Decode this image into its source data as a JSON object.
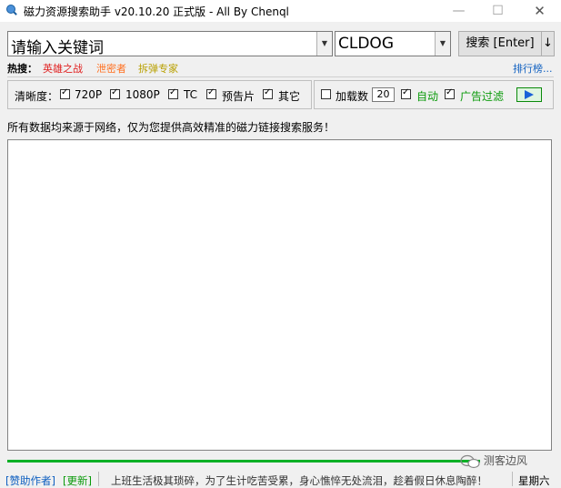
{
  "window": {
    "title": "磁力资源搜索助手 v20.10.20 正式版 - All By Chenql",
    "minimize_glyph": "—",
    "maximize_glyph": "☐",
    "close_glyph": "✕"
  },
  "search": {
    "keyword_value": "请输入关键词",
    "engine_value": "CLDOG",
    "search_button_label": "搜索 [Enter]",
    "down_button_label": "↓"
  },
  "hot": {
    "label": "热搜：",
    "items": [
      "英雄之战",
      "泄密者",
      "拆弹专家"
    ],
    "colors": [
      "#e02020",
      "#ff7020",
      "#b8a000"
    ],
    "rank_link": "排行榜..."
  },
  "filters": {
    "quality_label": "清晰度：",
    "options": [
      {
        "label": "720P",
        "checked": true
      },
      {
        "label": "1080P",
        "checked": true
      },
      {
        "label": "TC",
        "checked": true
      },
      {
        "label": "预告片",
        "checked": true
      },
      {
        "label": "其它",
        "checked": true
      }
    ],
    "load_count_label": "加载数",
    "load_count_checked": false,
    "load_count_value": "20",
    "auto_label": "自动",
    "auto_checked": true,
    "ad_filter_label": "广告过滤",
    "ad_filter_checked": true
  },
  "notice": "所有数据均来源于网络，仅为您提供高效精准的磁力链接搜索服务！",
  "status": {
    "donate": "[赞助作者]",
    "update": "[更新]",
    "message": "上班生活极其琐碎，为了生计吃苦受累，身心憔悴无处流泪，趁着假日休息陶醉！",
    "day": "星期六",
    "watermark": "测客边风"
  },
  "colors": {
    "accent_green": "#06b025",
    "link_blue": "#1060c0"
  }
}
